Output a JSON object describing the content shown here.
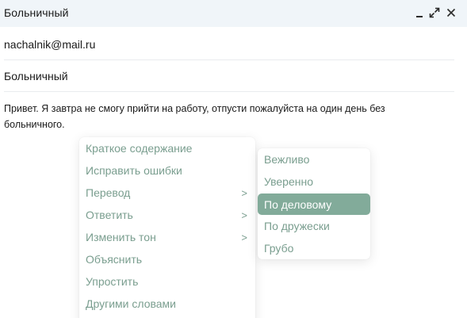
{
  "window": {
    "title": "Больничный",
    "controls": {
      "minimize_icon": "minimize-icon",
      "expand_icon": "expand-icon",
      "close_icon": "close-icon"
    }
  },
  "email": {
    "to": "nachalnik@mail.ru",
    "subject": "Больничный",
    "body_line1": "Привет. Я завтра не смогу прийти на работу, отпусти пожалуйста на один день без",
    "body_line2": "больничного."
  },
  "context_menu": {
    "items": [
      {
        "label": "Краткое содержание",
        "arrow": ""
      },
      {
        "label": "Исправить ошибки",
        "arrow": ""
      },
      {
        "label": "Перевод",
        "arrow": ">"
      },
      {
        "label": "Ответить",
        "arrow": ">"
      },
      {
        "label": "Изменить тон",
        "arrow": ">"
      },
      {
        "label": "Объяснить",
        "arrow": ""
      },
      {
        "label": "Упростить",
        "arrow": ""
      },
      {
        "label": "Другими словами",
        "arrow": ""
      }
    ]
  },
  "tone_submenu": {
    "items": [
      {
        "label": "Вежливо"
      },
      {
        "label": "Уверенно"
      },
      {
        "label": "По деловому"
      },
      {
        "label": "По дружески"
      },
      {
        "label": "Грубо"
      }
    ],
    "selected": "По деловому"
  },
  "colors": {
    "accent": "#82ab9a",
    "menu_text": "#7a9e8f",
    "titlebar_bg": "#f0f5f9"
  }
}
